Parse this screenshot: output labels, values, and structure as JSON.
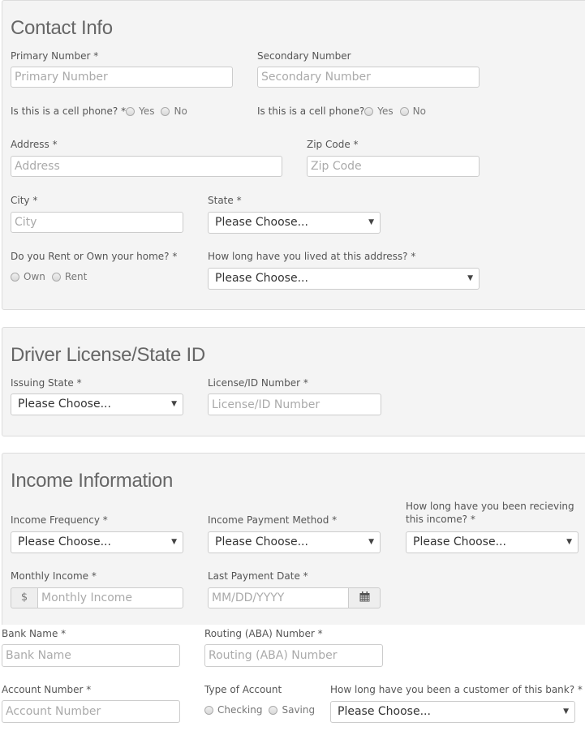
{
  "contact": {
    "title": "Contact Info",
    "primary_number": {
      "label": "Primary Number *",
      "placeholder": "Primary Number"
    },
    "secondary_number": {
      "label": "Secondary Number",
      "placeholder": "Secondary Number"
    },
    "primary_cell": {
      "label": "Is this is a cell phone? *",
      "options": [
        "Yes",
        "No"
      ]
    },
    "secondary_cell": {
      "label": "Is this is a cell phone?",
      "options": [
        "Yes",
        "No"
      ]
    },
    "address": {
      "label": "Address *",
      "placeholder": "Address"
    },
    "zip": {
      "label": "Zip Code *",
      "placeholder": "Zip Code"
    },
    "city": {
      "label": "City *",
      "placeholder": "City"
    },
    "state": {
      "label": "State *",
      "value": "Please Choose..."
    },
    "rent_own": {
      "label": "Do you Rent or Own your home? *",
      "options": [
        "Own",
        "Rent"
      ]
    },
    "time_at_address": {
      "label": "How long have you lived at this address? *",
      "value": "Please Choose..."
    }
  },
  "license": {
    "title": "Driver License/State ID",
    "issuing_state": {
      "label": "Issuing State *",
      "value": "Please Choose..."
    },
    "license_number": {
      "label": "License/ID Number *",
      "placeholder": "License/ID Number"
    }
  },
  "income": {
    "title": "Income Information",
    "frequency": {
      "label": "Income Frequency *",
      "value": "Please Choose..."
    },
    "payment_method": {
      "label": "Income Payment Method *",
      "value": "Please Choose..."
    },
    "duration": {
      "label": "How long have you been recieving this income? *",
      "value": "Please Choose..."
    },
    "monthly_income": {
      "label": "Monthly Income *",
      "placeholder": "Monthly Income",
      "prefix": "$"
    },
    "last_payment": {
      "label": "Last Payment Date *",
      "placeholder": "MM/DD/YYYY",
      "icon": "calendar-icon"
    }
  },
  "bank": {
    "bank_name": {
      "label": "Bank Name *",
      "placeholder": "Bank Name"
    },
    "routing": {
      "label": "Routing (ABA) Number *",
      "placeholder": "Routing (ABA) Number"
    },
    "account_number": {
      "label": "Account Number *",
      "placeholder": "Account Number"
    },
    "account_type": {
      "label": "Type of Account",
      "options": [
        "Checking",
        "Saving"
      ]
    },
    "customer_duration": {
      "label": "How long have you been a customer of this bank? *",
      "value": "Please Choose..."
    }
  },
  "dropdown_arrow": "▼"
}
